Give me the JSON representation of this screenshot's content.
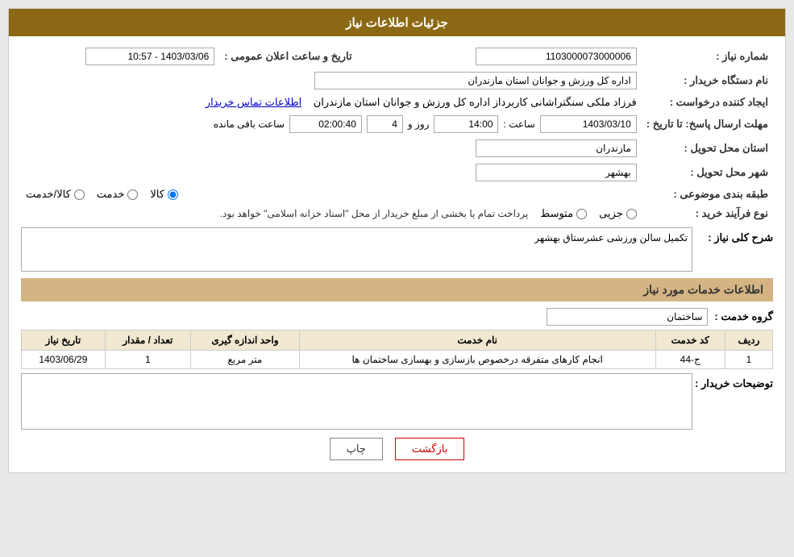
{
  "header": {
    "title": "جزئیات اطلاعات نیاز"
  },
  "fields": {
    "shomara_niaz_label": "شماره نیاز :",
    "shomara_niaz_value": "1103000073000006",
    "name_dastgah_label": "نام دستگاه خریدار :",
    "name_dastgah_value": "اداره کل ورزش و جوانان استان مازندران",
    "creator_label": "ایجاد کننده درخواست :",
    "creator_value": "فرزاد ملکی سنگتراشانی کاربرداز اداره کل ورزش و جوانان استان مازندران",
    "contact_link": "اطلاعات تماس خریدار",
    "deadline_label": "مهلت ارسال پاسخ: تا تاریخ :",
    "deadline_date": "1403/03/10",
    "deadline_time_label": "ساعت :",
    "deadline_time": "14:00",
    "deadline_day_label": "روز و",
    "deadline_days": "4",
    "deadline_remaining_label": "ساعت باقی مانده",
    "deadline_remaining": "02:00:40",
    "announce_label": "تاریخ و ساعت اعلان عمومی :",
    "announce_value": "1403/03/06 - 10:57",
    "province_label": "استان محل تحویل :",
    "province_value": "مازندران",
    "city_label": "شهر محل تحویل :",
    "city_value": "بهشهر",
    "category_label": "طبقه بندی موضوعی :",
    "category_kala": "کالا",
    "category_khedmat": "خدمت",
    "category_kala_khedmat": "کالا/خدمت",
    "process_label": "نوع فرآیند خرید :",
    "process_jozvi": "جزیی",
    "process_mottavasset": "متوسط",
    "process_note": "پرداخت تمام یا بخشی از مبلغ خریدار از محل \"اسناد خزانه اسلامی\" خواهد بود."
  },
  "sharh": {
    "label": "شرح کلی نیاز :",
    "value": "تکمیل سالن ورزشی عشرستاق بهشهر"
  },
  "services_section": {
    "title": "اطلاعات خدمات مورد نیاز",
    "group_label": "گروه خدمت :",
    "group_value": "ساختمان",
    "table": {
      "headers": [
        "ردیف",
        "کد خدمت",
        "نام خدمت",
        "واحد اندازه گیری",
        "تعداد / مقدار",
        "تاریخ نیاز"
      ],
      "rows": [
        {
          "radif": "1",
          "code": "ج-44",
          "name": "انجام کارهای متفرقه درخصوص بازسازی و بهسازی ساختمان ها",
          "unit": "متر مربع",
          "count": "1",
          "date": "1403/06/29"
        }
      ]
    }
  },
  "buyer_desc": {
    "label": "توضیحات خریدار :",
    "value": ""
  },
  "buttons": {
    "print": "چاپ",
    "back": "بازگشت"
  }
}
